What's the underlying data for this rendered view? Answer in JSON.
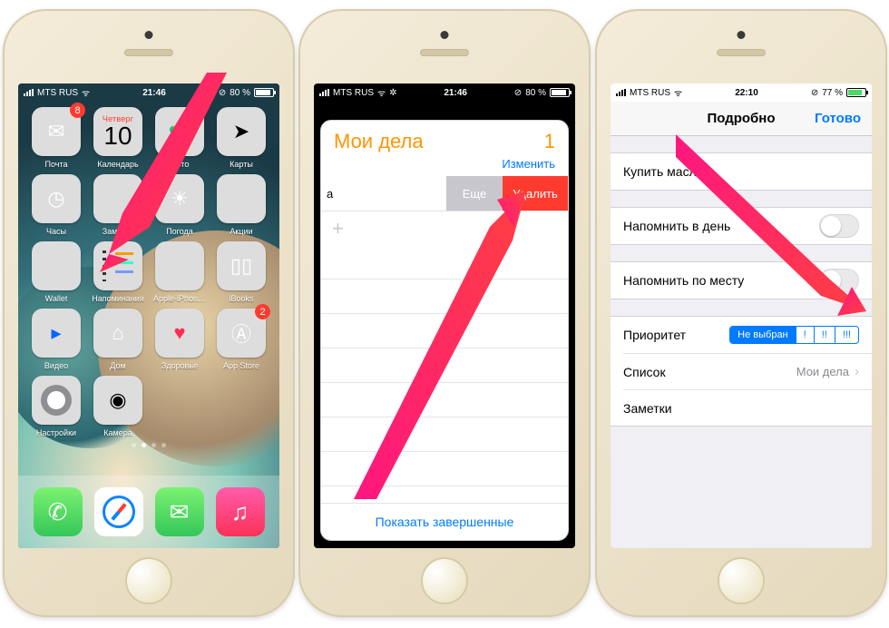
{
  "status": {
    "carrier": "MTS RUS",
    "time1": "21:46",
    "time2": "21:46",
    "time3": "22:10",
    "battery1": "80 %",
    "battery2": "80 %",
    "battery3": "77 %"
  },
  "homescreen": {
    "calendar": {
      "dow": "Четверг",
      "day": "10"
    },
    "apps": [
      {
        "label": "Почта",
        "cls": "t-mail",
        "icon": "✉",
        "badge": "8"
      },
      {
        "label": "Календарь",
        "cls": "calendar",
        "icon": ""
      },
      {
        "label": "Фото",
        "cls": "t-photos",
        "icon": "✿"
      },
      {
        "label": "Карты",
        "cls": "t-maps",
        "icon": "➤"
      },
      {
        "label": "Часы",
        "cls": "t-clock",
        "icon": "◷"
      },
      {
        "label": "Заметки",
        "cls": "t-notes",
        "icon": ""
      },
      {
        "label": "Погода",
        "cls": "t-weather",
        "icon": "☀"
      },
      {
        "label": "Акции",
        "cls": "t-stocks",
        "icon": ""
      },
      {
        "label": "Wallet",
        "cls": "t-wallet",
        "icon": ""
      },
      {
        "label": "Напоминания",
        "cls": "t-reminders",
        "icon": ""
      },
      {
        "label": "Apple·iPhon…",
        "cls": "t-folder",
        "icon": ""
      },
      {
        "label": "iBooks",
        "cls": "t-ibooks",
        "icon": "▯▯"
      },
      {
        "label": "Видео",
        "cls": "t-video",
        "icon": "▸"
      },
      {
        "label": "Дом",
        "cls": "t-home",
        "icon": "⌂"
      },
      {
        "label": "Здоровье",
        "cls": "t-health",
        "icon": "♥"
      },
      {
        "label": "App Store",
        "cls": "t-appstore",
        "icon": "Ⓐ",
        "badge": "2"
      },
      {
        "label": "Настройки",
        "cls": "t-settings",
        "icon": ""
      },
      {
        "label": "Камера",
        "cls": "t-camera",
        "icon": "◉"
      }
    ],
    "dock": [
      {
        "name": "phone",
        "cls": "t-phone",
        "icon": "✆"
      },
      {
        "name": "safari",
        "cls": "t-safari",
        "icon": ""
      },
      {
        "name": "messages",
        "cls": "t-messages",
        "icon": "✉"
      },
      {
        "name": "music",
        "cls": "t-music",
        "icon": "♫"
      }
    ]
  },
  "reminders": {
    "title": "Мои дела",
    "count": "1",
    "edit": "Изменить",
    "more": "Еще",
    "delete": "Удалить",
    "show_done": "Показать завершенные"
  },
  "details": {
    "nav_title": "Подробно",
    "done": "Готово",
    "item_title": "Купить масло",
    "remind_day": "Напомнить в день",
    "remind_loc": "Напомнить по месту",
    "priority_label": "Приоритет",
    "priority_opts": [
      "Не выбран",
      "!",
      "!!",
      "!!!"
    ],
    "list_label": "Список",
    "list_value": "Мои дела",
    "notes_label": "Заметки"
  }
}
